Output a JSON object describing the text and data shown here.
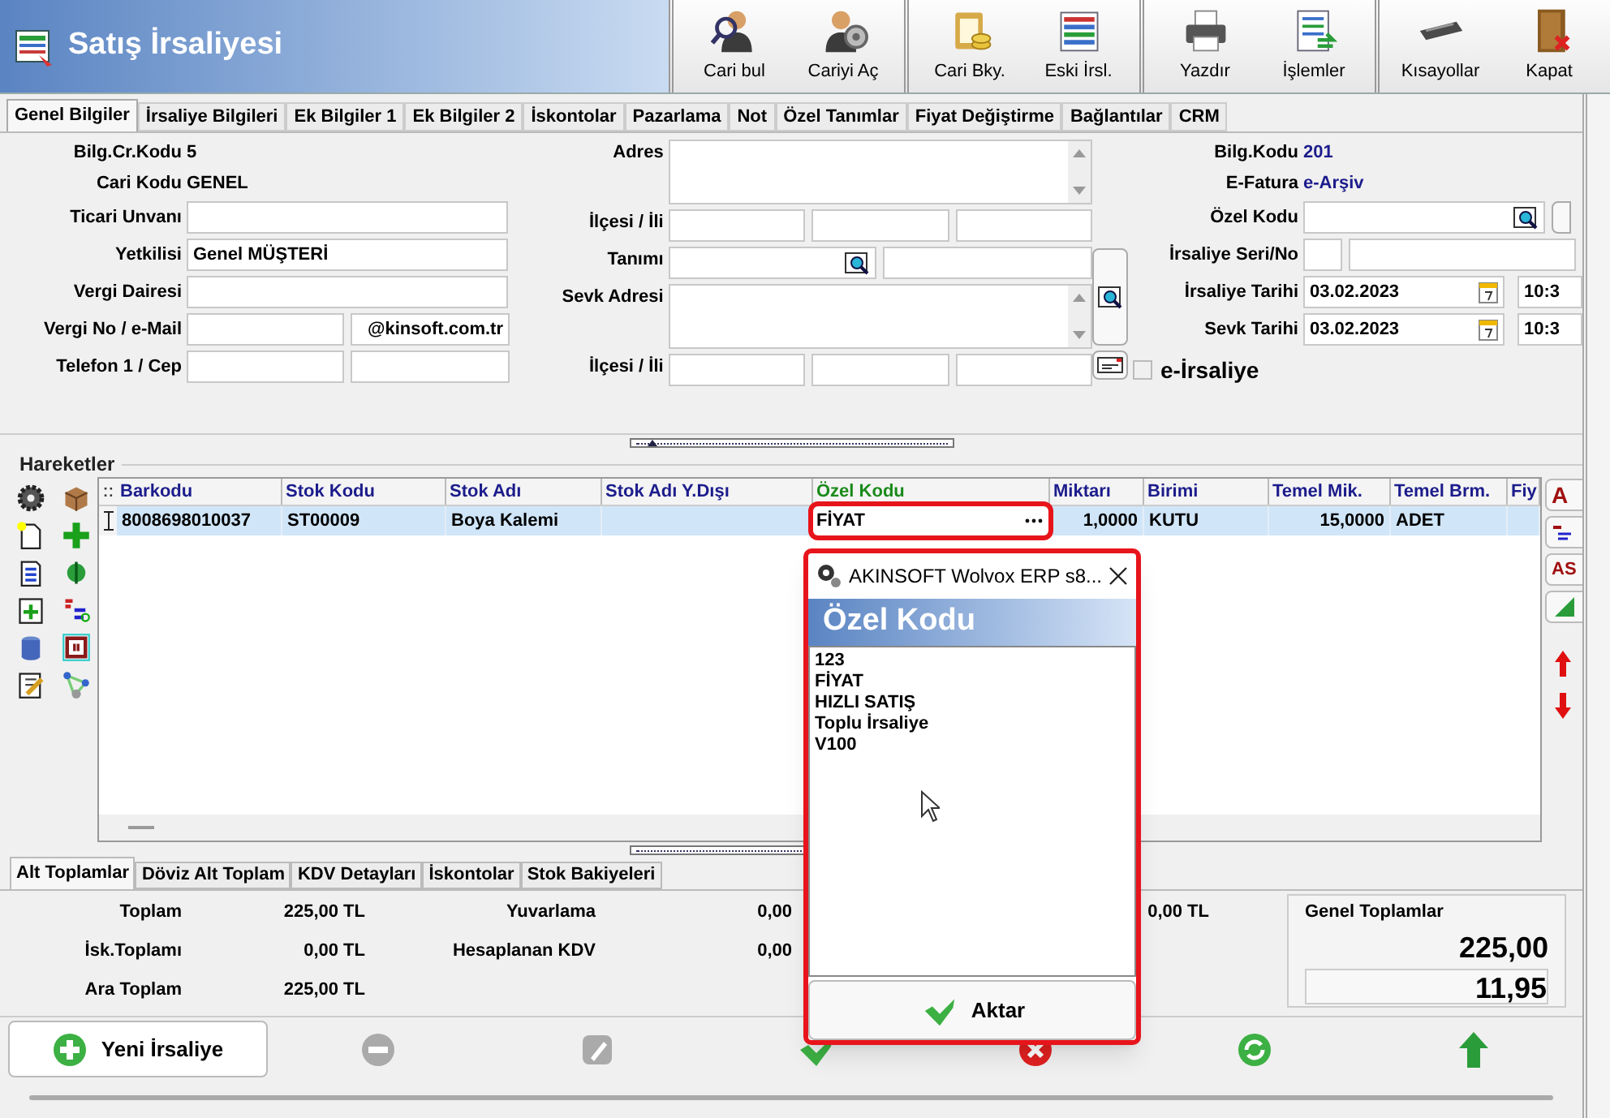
{
  "window": {
    "title": "Satış İrsaliyesi"
  },
  "toolbar": {
    "groups": [
      [
        "Cari bul",
        "Cariyi Aç"
      ],
      [
        "Cari Bky.",
        "Eski İrsl."
      ],
      [
        "Yazdır",
        "İşlemler"
      ],
      [
        "Kısayollar",
        "Kapat"
      ]
    ]
  },
  "tabs": [
    {
      "label": "Genel Bilgiler",
      "selected": true
    },
    {
      "label": "İrsaliye Bilgileri",
      "selected": false
    },
    {
      "label": "Ek Bilgiler 1",
      "selected": false
    },
    {
      "label": "Ek Bilgiler 2",
      "selected": false
    },
    {
      "label": "İskontolar",
      "selected": false
    },
    {
      "label": "Pazarlama",
      "selected": false
    },
    {
      "label": "Not",
      "selected": false
    },
    {
      "label": "Özel Tanımlar",
      "selected": false
    },
    {
      "label": "Fiyat Değiştirme",
      "selected": false
    },
    {
      "label": "Bağlantılar",
      "selected": false
    },
    {
      "label": "CRM",
      "selected": false
    }
  ],
  "form": {
    "left": [
      {
        "kind": "text",
        "label": "Bilg.Cr.Kodu",
        "value": "5"
      },
      {
        "kind": "text",
        "label": "Cari Kodu",
        "value": "GENEL"
      },
      {
        "kind": "input",
        "label": "Ticari Unvanı"
      },
      {
        "kind": "input",
        "label": "Yetkilisi",
        "value": "Genel MÜŞTERİ"
      },
      {
        "kind": "input",
        "label": "Vergi Dairesi"
      },
      {
        "kind": "pair",
        "label": "Vergi No / e-Mail",
        "value_2": "@kinsoft.com.tr"
      },
      {
        "kind": "pair",
        "label": "Telefon 1 / Cep"
      }
    ],
    "middle": [
      {
        "kind": "textarea",
        "label": "Adres"
      },
      {
        "kind": "triple",
        "label": "İlçesi / İli"
      },
      {
        "kind": "lookup_pair",
        "label": "Tanımı"
      },
      {
        "kind": "textarea",
        "label": "Sevk Adresi"
      },
      {
        "kind": "triple",
        "label": "İlçesi / İli"
      }
    ],
    "right": [
      {
        "kind": "link",
        "label": "Bilg.Kodu",
        "value": "201"
      },
      {
        "kind": "link",
        "label": "E-Fatura",
        "value": "e-Arşiv"
      },
      {
        "kind": "lookup",
        "label": "Özel Kodu"
      },
      {
        "kind": "pair_small",
        "label": "İrsaliye Seri/No"
      },
      {
        "kind": "date",
        "label": "İrsaliye Tarihi",
        "value": "03.02.2023",
        "time": "10:3"
      },
      {
        "kind": "date",
        "label": "Sevk Tarihi",
        "value": "03.02.2023",
        "time": "10:3"
      },
      {
        "kind": "checkbox",
        "label": "e-İrsaliye",
        "checked": false
      }
    ]
  },
  "movements": {
    "title": "Hareketler",
    "columns": [
      {
        "label": "Barkodu",
        "kind": "text",
        "focused": false
      },
      {
        "label": "Stok Kodu",
        "kind": "text",
        "focused": false
      },
      {
        "label": "Stok Adı",
        "kind": "text",
        "focused": false
      },
      {
        "label": "Stok Adı Y.Dışı",
        "focused": false
      },
      {
        "label": "Özel Kodu",
        "kind": "text",
        "focused": true
      },
      {
        "label": "Miktarı",
        "kind": "number",
        "focused": false
      },
      {
        "label": "Birimi",
        "kind": "text",
        "focused": false
      },
      {
        "label": "Temel Mik.",
        "kind": "number",
        "focused": false
      },
      {
        "label": "Temel Brm.",
        "kind": "text",
        "focused": false
      },
      {
        "label": "Fiy",
        "focused": false
      }
    ],
    "rows": [
      {
        "selected": true,
        "cells": [
          "8008698010037",
          "ST00009",
          "Boya Kalemi",
          null,
          "FİYAT",
          "1,0000",
          "KUTU",
          "15,0000",
          "ADET",
          null
        ]
      }
    ],
    "side_buttons": [
      {
        "kind": "text",
        "label": "A"
      },
      {
        "kind": "icon"
      },
      {
        "kind": "text",
        "label": "AS"
      },
      {
        "kind": "icon"
      }
    ]
  },
  "bottom_tabs": [
    {
      "label": "Alt Toplamlar",
      "selected": true
    },
    {
      "label": "Döviz Alt Toplam",
      "selected": false
    },
    {
      "label": "KDV Detayları",
      "selected": false
    },
    {
      "label": "İskontolar",
      "selected": false
    },
    {
      "label": "Stok Bakiyeleri",
      "selected": false
    }
  ],
  "totals": {
    "column_1": [
      {
        "label": "Toplam",
        "value": "225,00 TL"
      },
      {
        "label": "İsk.Toplamı",
        "value": "0,00 TL"
      },
      {
        "label": "Ara Toplam",
        "value": "225,00 TL"
      }
    ],
    "column_2": [
      {
        "label": "Yuvarlama",
        "value": "0,00"
      },
      {
        "label": "Hesaplanan KDV",
        "value": "0,00"
      }
    ],
    "column_3": [
      {
        "value": "0,00 TL"
      }
    ],
    "grand": {
      "title": "Genel Toplamlar",
      "values": [
        "225,00",
        "11,95"
      ]
    }
  },
  "actions": [
    {
      "kind": "add",
      "label": "Yeni İrsaliye"
    },
    {
      "kind": "remove"
    },
    {
      "kind": "edit"
    },
    {
      "kind": "save"
    },
    {
      "kind": "cancel"
    },
    {
      "kind": "refresh"
    },
    {
      "kind": "up"
    }
  ],
  "dialog": {
    "title": "AKINSOFT Wolvox ERP s8...",
    "heading": "Özel Kodu",
    "items": [
      "123",
      "FİYAT",
      "HIZLI SATIŞ",
      "Toplu İrsaliye",
      "V100"
    ],
    "button": "Aktar"
  }
}
